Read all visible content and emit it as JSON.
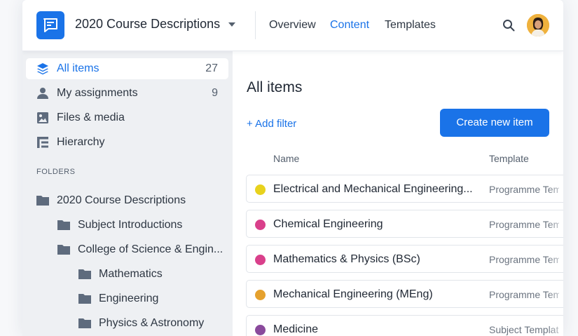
{
  "header": {
    "project_title": "2020 Course Descriptions",
    "tabs": [
      {
        "label": "Overview",
        "active": false
      },
      {
        "label": "Content",
        "active": true
      },
      {
        "label": "Templates",
        "active": false
      }
    ]
  },
  "sidebar": {
    "items": [
      {
        "label": "All items",
        "count": "27",
        "icon": "layers-icon",
        "active": true
      },
      {
        "label": "My assignments",
        "count": "9",
        "icon": "person-icon",
        "active": false
      },
      {
        "label": "Files & media",
        "count": "",
        "icon": "image-icon",
        "active": false
      },
      {
        "label": "Hierarchy",
        "count": "",
        "icon": "hierarchy-icon",
        "active": false
      }
    ],
    "folders_heading": "FOLDERS",
    "folders": [
      {
        "label": "2020 Course Descriptions",
        "level": 0
      },
      {
        "label": "Subject Introductions",
        "level": 1
      },
      {
        "label": "College of Science & Engin...",
        "level": 1
      },
      {
        "label": "Mathematics",
        "level": 2
      },
      {
        "label": "Engineering",
        "level": 2
      },
      {
        "label": "Physics & Astronomy",
        "level": 2
      }
    ]
  },
  "main": {
    "title": "All items",
    "add_filter_label": "+ Add filter",
    "create_button_label": "Create new item",
    "columns": {
      "name": "Name",
      "template": "Template"
    },
    "rows": [
      {
        "name": "Electrical and Mechanical Engineering...",
        "template": "Programme Template",
        "color": "#e8d21d"
      },
      {
        "name": "Chemical Engineering",
        "template": "Programme Template",
        "color": "#d9408b"
      },
      {
        "name": "Mathematics & Physics (BSc)",
        "template": "Programme Template",
        "color": "#d9408b"
      },
      {
        "name": "Mechanical Engineering (MEng)",
        "template": "Programme Template",
        "color": "#e5a12e"
      },
      {
        "name": "Medicine",
        "template": "Subject Template",
        "color": "#8a4a9c"
      }
    ]
  },
  "colors": {
    "accent": "#1a73e8",
    "sidebar_bg": "#eef0f3"
  }
}
